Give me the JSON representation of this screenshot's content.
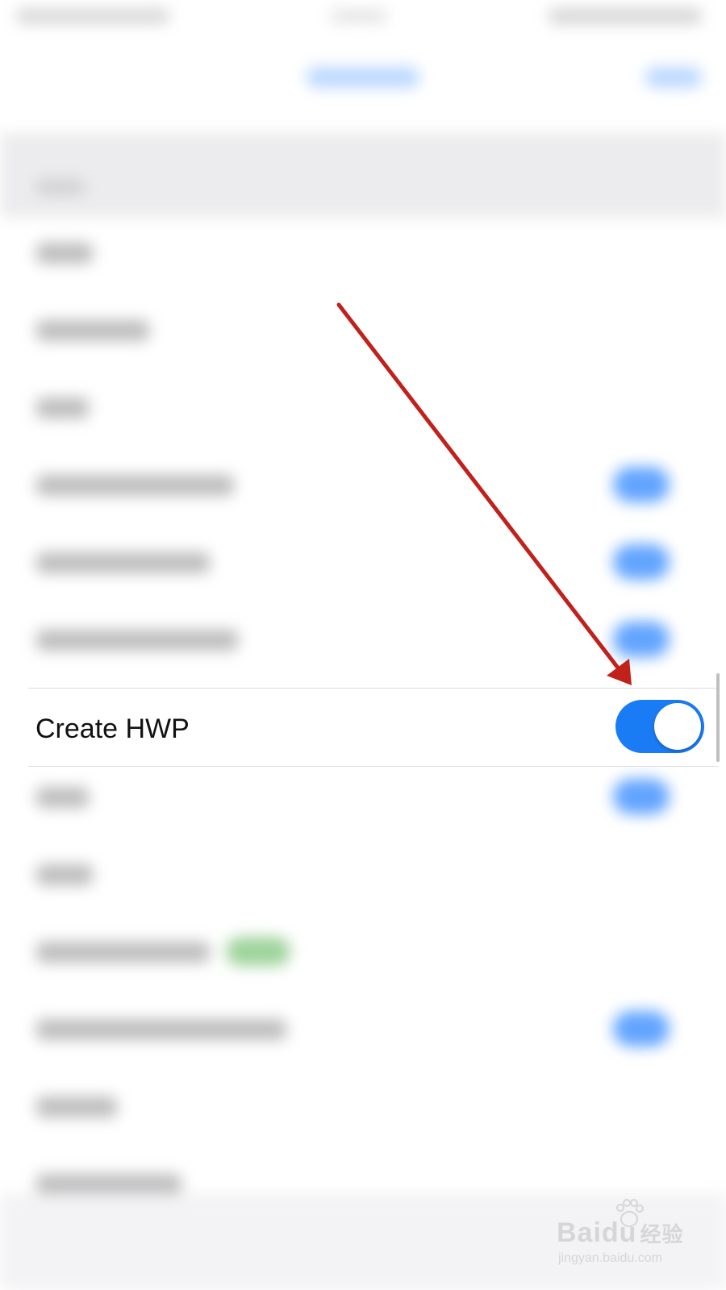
{
  "settings_row": {
    "label": "Create HWP",
    "toggle_state": "on"
  },
  "colors": {
    "toggle_on": "#1a7cf5",
    "annotation_arrow": "#c0211b"
  },
  "watermark": {
    "main": "Baidu",
    "cjk": "经验",
    "url": "jingyan.baidu.com"
  }
}
